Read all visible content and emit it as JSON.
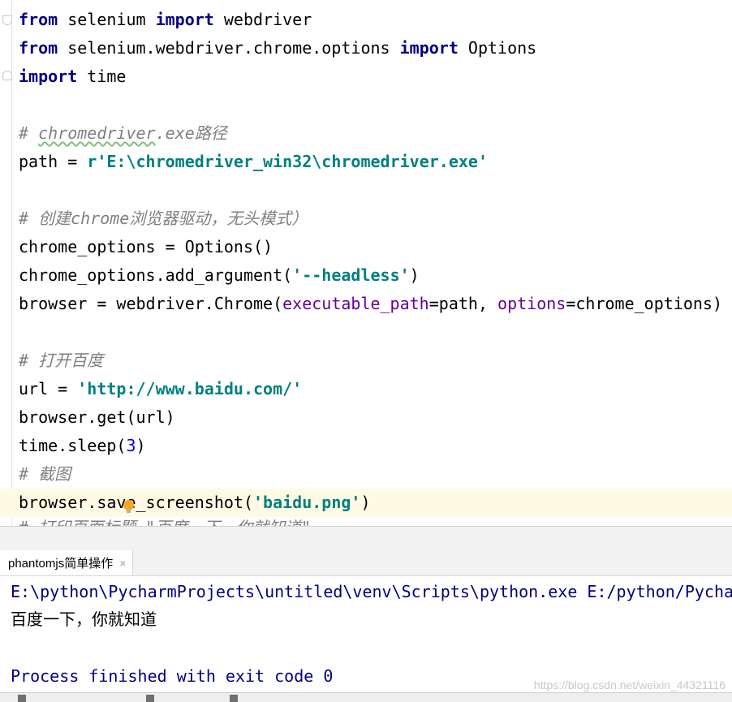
{
  "editor": {
    "l1": {
      "kw1": "from",
      "t1": " selenium ",
      "kw2": "import",
      "t2": " webdriver"
    },
    "l2": {
      "kw1": "from",
      "t1": " selenium.webdriver.chrome.options ",
      "kw2": "import",
      "t2": " Options"
    },
    "l3": {
      "kw1": "import",
      "t1": " time"
    },
    "l5": {
      "hash": "# ",
      "word": "chromedriver",
      "rest": ".exe路径"
    },
    "l6": {
      "t1": "path = ",
      "str": "r'E:\\chromedriver_win32\\chromedriver.exe'"
    },
    "l8": {
      "comment": "# 创建chrome浏览器驱动，无头模式）"
    },
    "l9": {
      "t1": "chrome_options = Options()"
    },
    "l10": {
      "t1": "chrome_options.add_argument(",
      "str": "'--headless'",
      "t2": ")"
    },
    "l11": {
      "t1": "browser = webdriver.Chrome(",
      "p1": "executable_path",
      "t2": "=path, ",
      "p2": "options",
      "t3": "=chrome_options)"
    },
    "l13": {
      "comment": "# 打开百度"
    },
    "l14": {
      "t1": "url = ",
      "str": "'http://www.baidu.com/'"
    },
    "l15": {
      "t1": "browser.get(url)"
    },
    "l16": {
      "t1": "time.sleep(",
      "num": "3",
      "t2": ")"
    },
    "l17": {
      "comment": "# 截图"
    },
    "l18": {
      "t1": "browser.save_screenshot(",
      "str": "'baidu.png'",
      "t2": ")"
    },
    "l19": {
      "comment": "# 打印页面标题 \"百度一下，你就知道\""
    }
  },
  "run_panel": {
    "tab_label": "phantomjs简单操作",
    "close_glyph": "×"
  },
  "console": {
    "command": "E:\\python\\PycharmProjects\\untitled\\venv\\Scripts\\python.exe E:/python/Pycha",
    "output": "百度一下，你就知道",
    "exit": "Process finished with exit code 0"
  },
  "watermark": "https://blog.csdn.net/weixin_44321116",
  "icons": [
    "lightbulb-icon",
    "fold-marker-icon",
    "close-icon"
  ]
}
